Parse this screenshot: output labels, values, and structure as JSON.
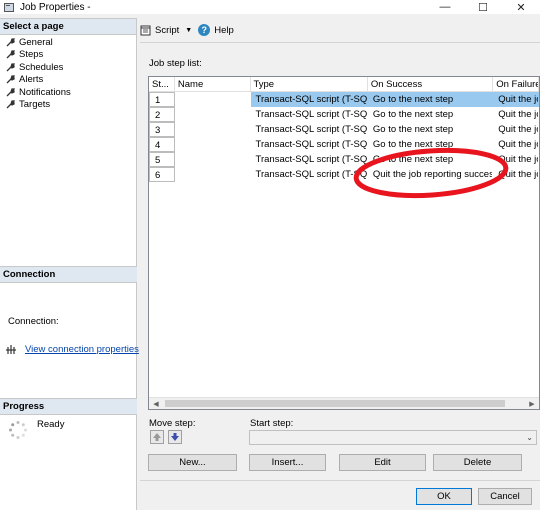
{
  "window": {
    "title": "Job Properties -",
    "minimize": "—",
    "maximize": "☐",
    "close": "✕"
  },
  "left": {
    "select_page_header": "Select a page",
    "pages": [
      "General",
      "Steps",
      "Schedules",
      "Alerts",
      "Notifications",
      "Targets"
    ],
    "connection_header": "Connection",
    "connection_label": "Connection:",
    "view_connection_link": "View connection properties",
    "progress_header": "Progress",
    "progress_status": "Ready"
  },
  "toolbar": {
    "script_label": "Script",
    "help_label": "Help"
  },
  "steps": {
    "list_label": "Job step list:",
    "columns": [
      "St...",
      "Name",
      "Type",
      "On Success",
      "On Failure"
    ],
    "rows": [
      {
        "step": "1",
        "name": "",
        "type": "Transact-SQL script (T-SQL)",
        "on_success": "Go to the next step",
        "on_failure": "Quit the job"
      },
      {
        "step": "2",
        "name": "",
        "type": "Transact-SQL script (T-SQL)",
        "on_success": "Go to the next step",
        "on_failure": "Quit the job"
      },
      {
        "step": "3",
        "name": "",
        "type": "Transact-SQL script (T-SQL)",
        "on_success": "Go to the next step",
        "on_failure": "Quit the job"
      },
      {
        "step": "4",
        "name": "",
        "type": "Transact-SQL script (T-SQL)",
        "on_success": "Go to the next step",
        "on_failure": "Quit the job"
      },
      {
        "step": "5",
        "name": "",
        "type": "Transact-SQL script (T-SQL)",
        "on_success": "Go to the next step",
        "on_failure": "Quit the job"
      },
      {
        "step": "6",
        "name": "",
        "type": "Transact-SQL script (T-SQL)",
        "on_success": "Quit the job reporting success",
        "on_failure": "Quit the job"
      }
    ],
    "selected_row": "1",
    "highlight_color": "#e8141e"
  },
  "controls": {
    "move_step_label": "Move step:",
    "start_step_label": "Start step:",
    "start_step_value": "",
    "new_button": "New...",
    "insert_button": "Insert...",
    "edit_button": "Edit",
    "delete_button": "Delete",
    "ok_button": "OK",
    "cancel_button": "Cancel"
  }
}
